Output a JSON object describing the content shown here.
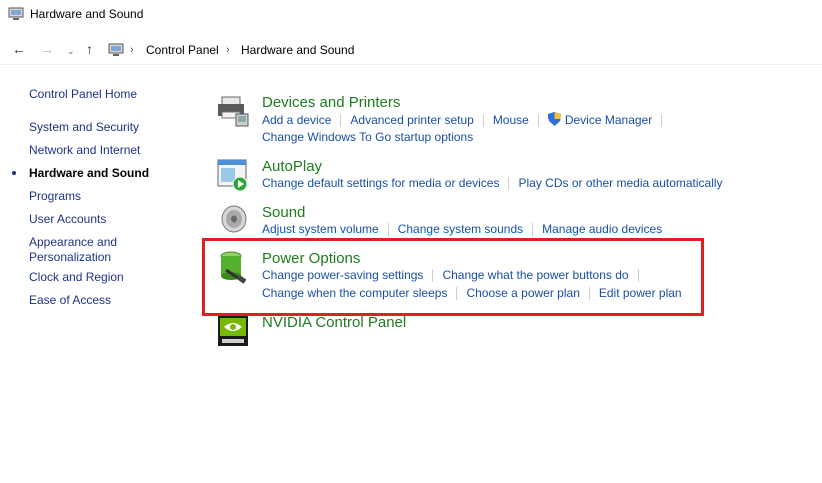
{
  "window": {
    "title": "Hardware and Sound"
  },
  "breadcrumb": {
    "items": [
      "Control Panel",
      "Hardware and Sound"
    ]
  },
  "sidebar": {
    "home": "Control Panel Home",
    "items": [
      {
        "label": "System and Security"
      },
      {
        "label": "Network and Internet"
      },
      {
        "label": "Hardware and Sound",
        "current": true
      },
      {
        "label": "Programs"
      },
      {
        "label": "User Accounts"
      },
      {
        "label": "Appearance and\nPersonalization"
      },
      {
        "label": "Clock and Region"
      },
      {
        "label": "Ease of Access"
      }
    ]
  },
  "categories": {
    "devices": {
      "title": "Devices and Printers",
      "icon": "printer-icon",
      "links": [
        "Add a device",
        "Advanced printer setup",
        "Mouse",
        "Device Manager",
        "Change Windows To Go startup options"
      ]
    },
    "autoplay": {
      "title": "AutoPlay",
      "icon": "autoplay-icon",
      "links": [
        "Change default settings for media or devices",
        "Play CDs or other media automatically"
      ]
    },
    "sound": {
      "title": "Sound",
      "icon": "speaker-icon",
      "links": [
        "Adjust system volume",
        "Change system sounds",
        "Manage audio devices"
      ]
    },
    "power": {
      "title": "Power Options",
      "icon": "battery-icon",
      "links": [
        "Change power-saving settings",
        "Change what the power buttons do",
        "Change when the computer sleeps",
        "Choose a power plan",
        "Edit power plan"
      ]
    },
    "nvidia": {
      "title": "NVIDIA Control Panel",
      "icon": "nvidia-icon",
      "links": []
    }
  },
  "colors": {
    "heading": "#1e7d1e",
    "link": "#1a4fa8",
    "highlight": "#e02020"
  }
}
